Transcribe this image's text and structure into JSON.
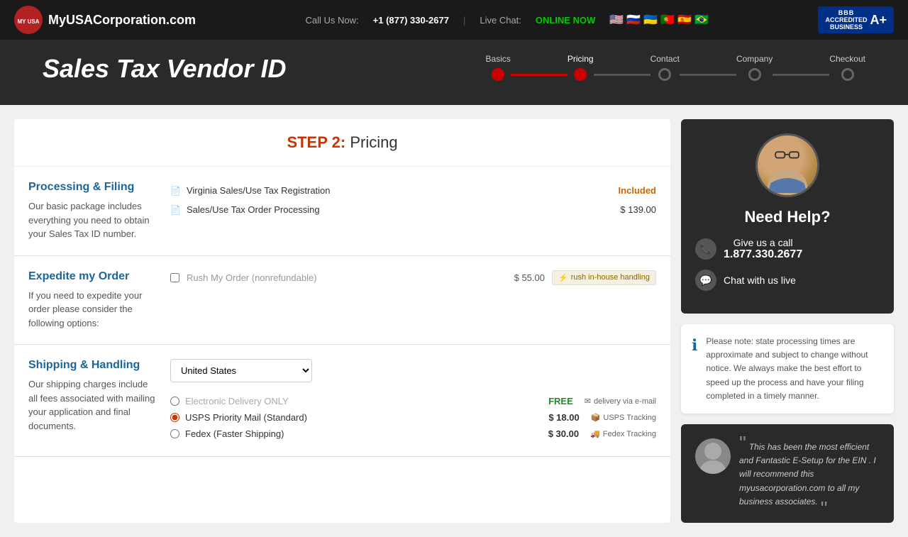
{
  "site": {
    "logo_text": "MyUSACorporation.com",
    "phone_label": "Call Us Now:",
    "phone_number": "+1 (877) 330-2677",
    "live_chat_label": "Live Chat:",
    "live_chat_status": "ONLINE NOW",
    "bbb_label": "BBB ACCREDITED BUSINESS",
    "bbb_rating": "A+"
  },
  "page_title": "Sales Tax Vendor ID",
  "steps": [
    {
      "label": "Basics",
      "state": "completed"
    },
    {
      "label": "Pricing",
      "state": "current"
    },
    {
      "label": "Contact",
      "state": "inactive"
    },
    {
      "label": "Company",
      "state": "inactive"
    },
    {
      "label": "Checkout",
      "state": "inactive"
    }
  ],
  "step_header": {
    "step_label": "STEP 2:",
    "step_name": " Pricing"
  },
  "sections": {
    "processing": {
      "title": "Processing & Filing",
      "description": "Our basic package includes everything you need to obtain your Sales Tax ID number.",
      "items": [
        {
          "label": "Virginia Sales/Use Tax Registration",
          "price": "Included"
        },
        {
          "label": "Sales/Use Tax Order Processing",
          "price": "$ 139.00"
        }
      ]
    },
    "expedite": {
      "title": "Expedite my Order",
      "description": "If you need to expedite your order please consider the following options:",
      "items": [
        {
          "label": "Rush My Order (nonrefundable)",
          "price": "$ 55.00",
          "badge": "rush in-house handling",
          "checked": false
        }
      ]
    },
    "shipping": {
      "title": "Shipping & Handling",
      "description": "Our shipping charges include all fees associated with mailing your application and final documents.",
      "country": "United States",
      "options": [
        {
          "label": "Electronic Delivery ONLY",
          "price": "FREE",
          "badge": "delivery via e-mail",
          "selected": false,
          "price_class": "free"
        },
        {
          "label": "USPS Priority Mail (Standard)",
          "price": "$ 18.00",
          "badge": "USPS Tracking",
          "selected": true,
          "price_class": ""
        },
        {
          "label": "Fedex (Faster Shipping)",
          "price": "$ 30.00",
          "badge": "Fedex Tracking",
          "selected": false,
          "price_class": ""
        }
      ]
    }
  },
  "sidebar": {
    "help": {
      "title": "Need Help?",
      "phone_label": "Give us a call",
      "phone_number": "1.877.330.2677",
      "chat_label": "Chat with us live"
    },
    "note": {
      "text": "Please note: state processing times are approximate and subject to change without notice. We always make the best effort to speed up the process and have your filing completed in a timely manner."
    },
    "testimonial": {
      "text": "This has been the most efficient and Fantastic E-Setup for the EIN . I will recommend this myusacorporation.com to all my business associates."
    }
  }
}
